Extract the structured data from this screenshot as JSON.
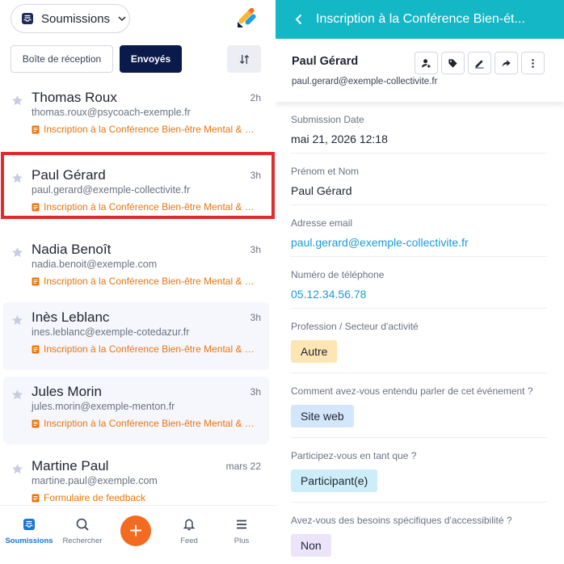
{
  "left": {
    "form_selector": {
      "label": "Soumissions"
    },
    "filters": {
      "inbox": "Boîte de réception",
      "sent": "Envoyés"
    },
    "submissions": [
      {
        "name": "Thomas Roux",
        "email": "thomas.roux@psycoach-exemple.fr",
        "time": "2h",
        "form": "Inscription à la Conférence Bien-être Mental & R..."
      },
      {
        "name": "Paul Gérard",
        "email": "paul.gerard@exemple-collectivite.fr",
        "time": "3h",
        "form": "Inscription à la Conférence Bien-être Mental & R..."
      },
      {
        "name": "Nadia Benoît",
        "email": "nadia.benoit@exemple.com",
        "time": "3h",
        "form": "Inscription à la Conférence Bien-être Mental & R..."
      },
      {
        "name": "Inès Leblanc",
        "email": "ines.leblanc@exemple-cotedazur.fr",
        "time": "3h",
        "form": "Inscription à la Conférence Bien-être Mental & R..."
      },
      {
        "name": "Jules Morin",
        "email": "jules.morin@exemple-menton.fr",
        "time": "3h",
        "form": "Inscription à la Conférence Bien-être Mental & R..."
      },
      {
        "name": "Martine  Paul",
        "email": "martine.paul@exemple.com",
        "time": "mars 22",
        "form": "Formulaire de feedback"
      }
    ],
    "nav": {
      "submissions": "Soumissions",
      "search": "Rechercher",
      "add": "+",
      "feed": "Feed",
      "more": "Plus"
    }
  },
  "right": {
    "header_title": "Inscription à la Conférence Bien-ét...",
    "sender": {
      "name": "Paul Gérard",
      "email": "paul.gerard@exemple-collectivite.fr"
    },
    "fields": [
      {
        "label": "Submission Date",
        "value": "mai 21, 2026 12:18"
      },
      {
        "label": "Prénom et Nom",
        "value": "Paul Gérard"
      },
      {
        "label": "Adresse email",
        "value": "paul.gerard@exemple-collectivite.fr"
      },
      {
        "label": "Numéro de téléphone",
        "value": "05.12.34.56.78"
      },
      {
        "label": "Profession / Secteur d'activité",
        "value": "Autre"
      },
      {
        "label": "Comment avez-vous entendu parler de cet événement ?",
        "value": "Site web"
      },
      {
        "label": "Participez-vous en tant que ?",
        "value": "Participant(e)"
      },
      {
        "label": "Avez-vous des besoins spécifiques d'accessibilité ?",
        "value": "Non"
      }
    ]
  },
  "colors": {
    "header": "#14b7c5",
    "accent_navy": "#0a1a4a",
    "form_orange": "#e8750f",
    "fab": "#f26b21",
    "link": "#1a9bd6",
    "selection": "#e02b2b",
    "pill_autre": "#fde6b3",
    "pill_site_web": "#d4e6fb",
    "pill_participant": "#cdeef8",
    "pill_non": "#ece4f8"
  }
}
